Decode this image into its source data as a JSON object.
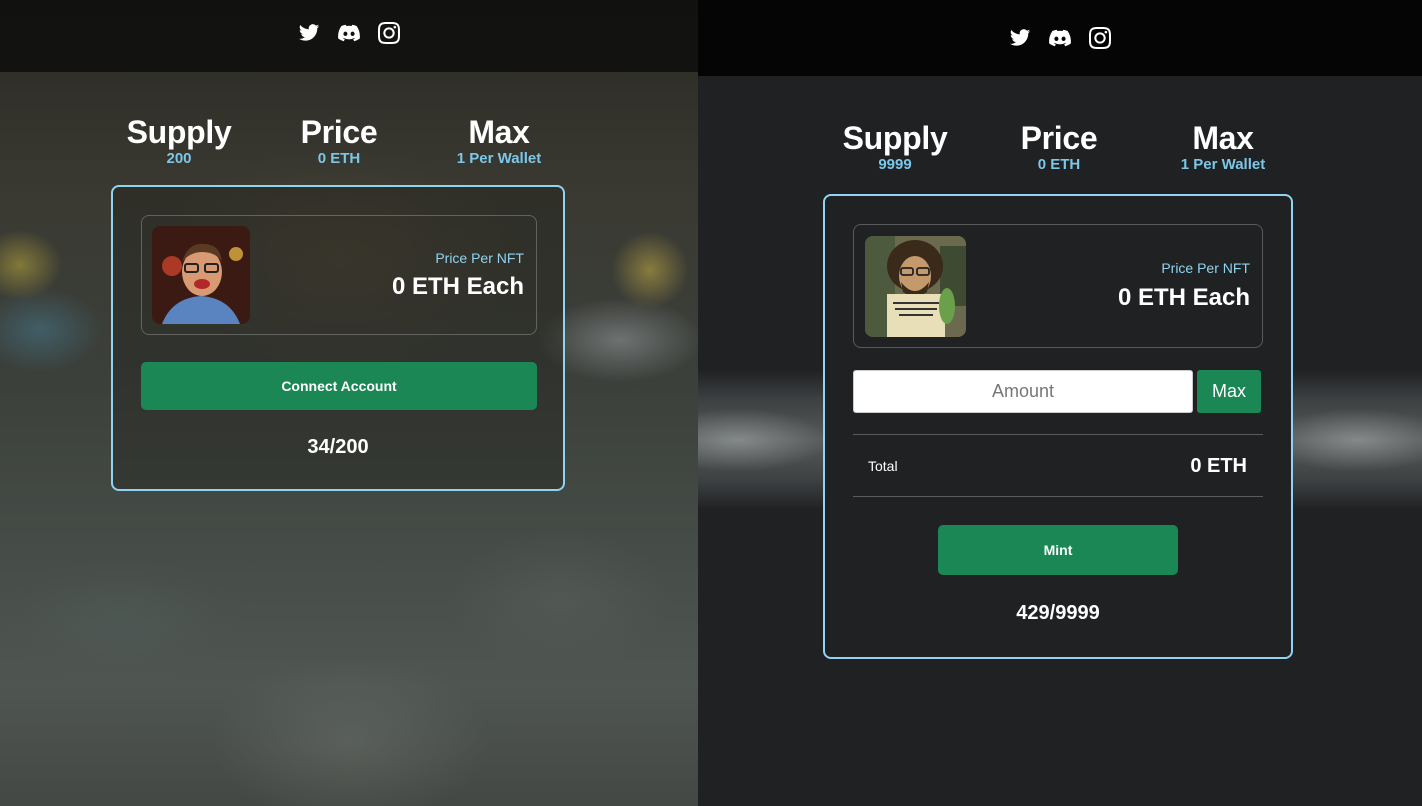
{
  "left": {
    "social": [
      "twitter-icon",
      "discord-icon",
      "instagram-icon"
    ],
    "stats": {
      "supply_title": "Supply",
      "supply_value": "200",
      "price_title": "Price",
      "price_value": "0 ETH",
      "max_title": "Max",
      "max_value": "1 Per Wallet"
    },
    "card": {
      "price_label": "Price Per NFT",
      "price_value": "0 ETH Each",
      "connect_button": "Connect Account",
      "counter": "34/200"
    }
  },
  "right": {
    "social": [
      "twitter-icon",
      "discord-icon",
      "instagram-icon"
    ],
    "stats": {
      "supply_title": "Supply",
      "supply_value": "9999",
      "price_title": "Price",
      "price_value": "0 ETH",
      "max_title": "Max",
      "max_value": "1 Per Wallet"
    },
    "card": {
      "price_label": "Price Per NFT",
      "price_value": "0 ETH Each",
      "amount_placeholder": "Amount",
      "max_button": "Max",
      "total_label": "Total",
      "total_value": "0 ETH",
      "mint_button": "Mint",
      "counter": "429/9999"
    }
  },
  "colors": {
    "accent": "#8fd4f0",
    "button": "#1b8755",
    "stat_value": "#7cc7e8"
  }
}
